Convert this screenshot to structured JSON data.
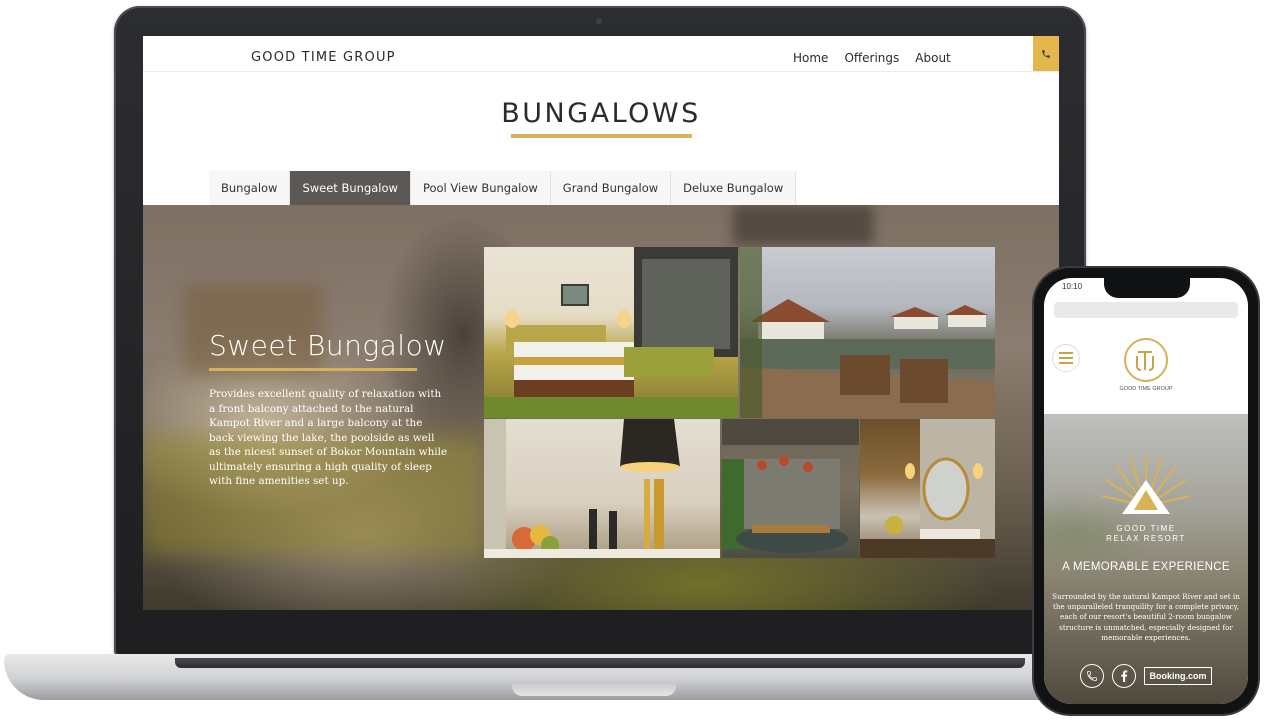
{
  "site": {
    "brand": "GOOD TIME GROUP",
    "nav": [
      "Home",
      "Offerings",
      "About"
    ]
  },
  "page": {
    "title": "BUNGALOWS",
    "tabs": [
      {
        "label": "Bungalow",
        "active": false
      },
      {
        "label": "Sweet Bungalow",
        "active": true
      },
      {
        "label": "Pool View Bungalow",
        "active": false
      },
      {
        "label": "Grand Bungalow",
        "active": false
      },
      {
        "label": "Deluxe Bungalow",
        "active": false
      }
    ]
  },
  "hero": {
    "heading": "Sweet Bungalow",
    "description": "Provides excellent quality of relaxation with a front balcony attached to the natural Kampot River and a large balcony at the back viewing the lake, the poolside as well as the nicest sunset of Bokor Mountain while ultimately ensuring a high quality of sleep with fine amenities set up."
  },
  "mobile": {
    "status_time": "10:10",
    "logo_text": "GOOD TIME GROUP",
    "resort_name_line1": "GOOD TIME",
    "resort_name_line2": "RELAX RESORT",
    "tagline": "A MEMORABLE EXPERIENCE",
    "description": "Surrounded by the natural Kampot River and set in the unparalleled tranquility for a complete privacy, each of our resort's beautiful 2-room bungalow structure is unmatched, especially designed for memorable experiences.",
    "booking_label": "Booking.com"
  },
  "colors": {
    "accent": "#d4b25a",
    "tab_active": "#5c5856",
    "phone_button": "#e3b74b"
  }
}
